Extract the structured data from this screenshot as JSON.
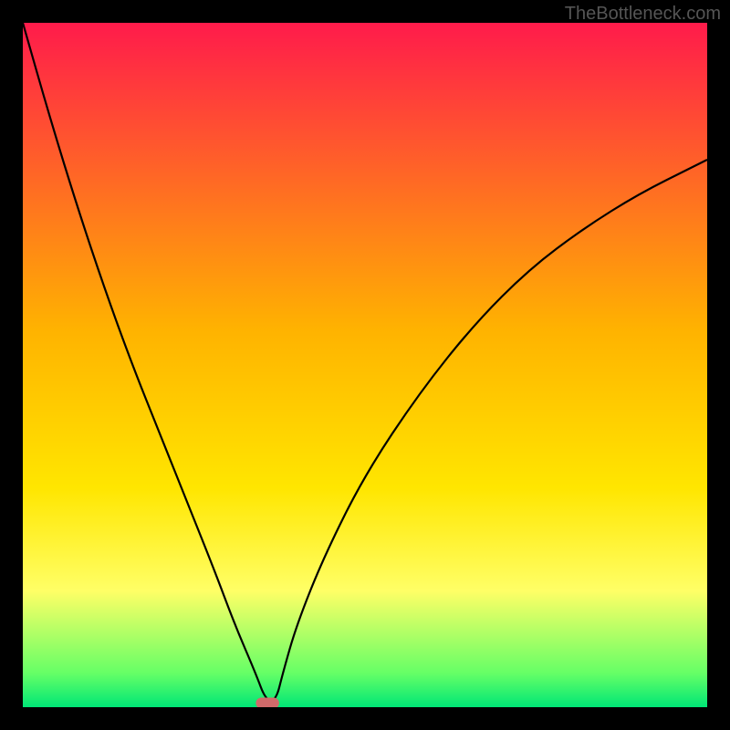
{
  "watermark": "TheBottleneck.com",
  "chart_data": {
    "type": "line",
    "title": "",
    "xlabel": "",
    "ylabel": "",
    "xlim": [
      0,
      100
    ],
    "ylim": [
      0,
      100
    ],
    "note": "Bottleneck-style V-curve over vertical rainbow gradient (red→yellow→green). Notch minimum at x≈36.",
    "gradient_stops": [
      {
        "offset": 0.0,
        "color": "#ff1b4b"
      },
      {
        "offset": 0.45,
        "color": "#ffb300"
      },
      {
        "offset": 0.68,
        "color": "#ffe600"
      },
      {
        "offset": 0.83,
        "color": "#ffff66"
      },
      {
        "offset": 0.95,
        "color": "#66ff66"
      },
      {
        "offset": 1.0,
        "color": "#00e676"
      }
    ],
    "series": [
      {
        "name": "bottleneck-curve",
        "x": [
          0,
          4,
          8,
          12,
          16,
          20,
          24,
          28,
          31,
          34,
          35.5,
          37,
          38,
          40,
          44,
          50,
          58,
          66,
          74,
          82,
          90,
          98,
          100
        ],
        "y": [
          100,
          86,
          73,
          61,
          50,
          40,
          30,
          20,
          12,
          5,
          1,
          1,
          5,
          12,
          22,
          34,
          46,
          56,
          64,
          70,
          75,
          79,
          80
        ]
      }
    ],
    "notch_marker": {
      "x": 35.75,
      "y": 0.6,
      "w": 3.4,
      "h": 1.6,
      "color": "#d06a6a"
    }
  }
}
